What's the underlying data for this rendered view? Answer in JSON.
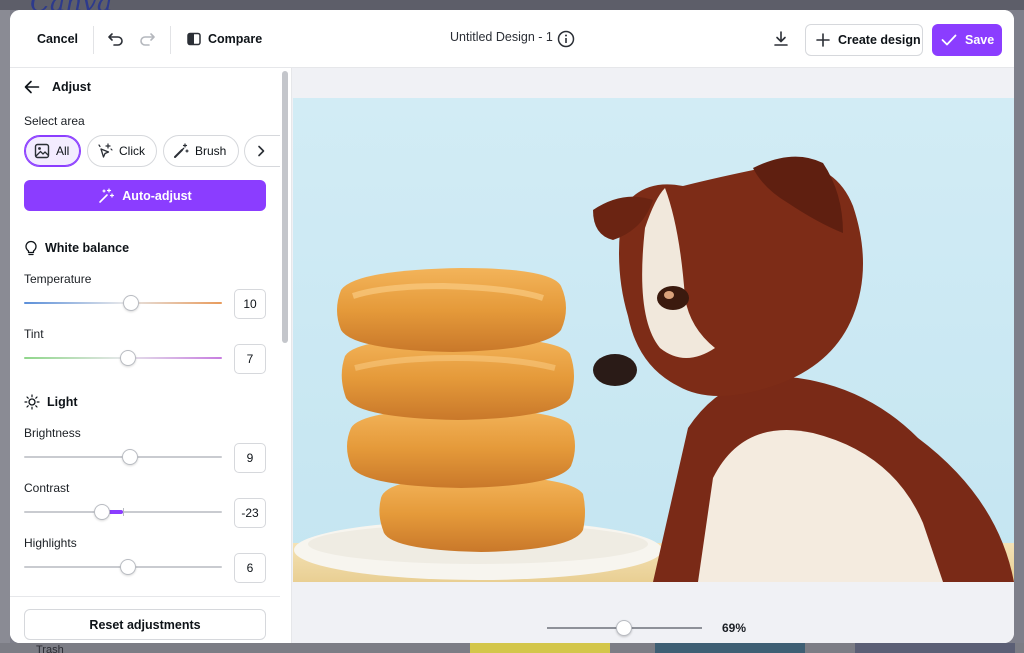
{
  "background": {
    "logo_text": "Canva",
    "trash_label": "Trash"
  },
  "topbar": {
    "cancel_label": "Cancel",
    "compare_label": "Compare",
    "title": "Untitled Design - 1",
    "create_design_label": "Create design",
    "save_label": "Save"
  },
  "panel": {
    "header": "Adjust",
    "select_area_label": "Select area",
    "chips": [
      {
        "label": "All",
        "icon": "image-icon",
        "active": true
      },
      {
        "label": "Click",
        "icon": "click-sparkle-icon"
      },
      {
        "label": "Brush",
        "icon": "magic-brush-icon"
      }
    ],
    "auto_adjust_label": "Auto-adjust",
    "white_balance": {
      "title": "White balance",
      "temperature": {
        "label": "Temperature",
        "value": "10",
        "level": 10
      },
      "tint": {
        "label": "Tint",
        "value": "7",
        "level": 7
      }
    },
    "light": {
      "title": "Light",
      "brightness": {
        "label": "Brightness",
        "value": "9",
        "level": 9
      },
      "contrast": {
        "label": "Contrast",
        "value": "-23",
        "level": -23
      },
      "highlights": {
        "label": "Highlights",
        "value": "6",
        "level": 6
      }
    },
    "reset_label": "Reset adjustments"
  },
  "canvas": {
    "zoom_label": "69%",
    "zoom_level": 0.6
  },
  "colors": {
    "accent": "#8b3dff",
    "photo_sky": "#cfe9f3"
  }
}
